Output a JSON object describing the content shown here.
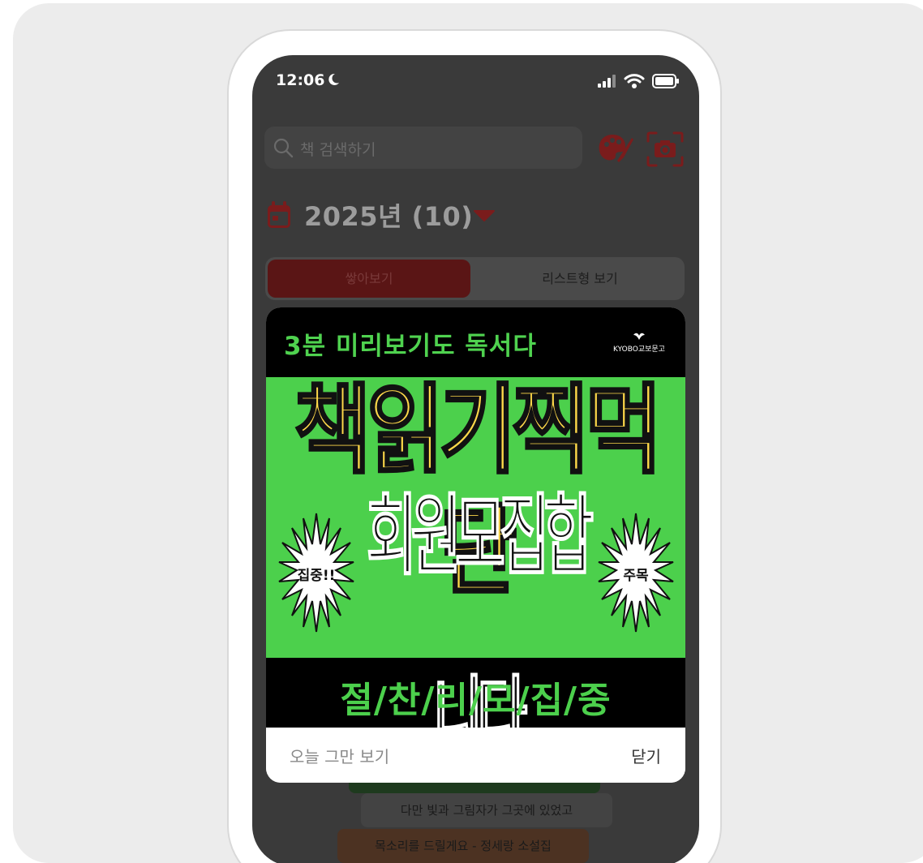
{
  "status_bar": {
    "time": "12:06"
  },
  "search": {
    "placeholder": "책 검색하기"
  },
  "year_selector": {
    "label": "2025년 (10)"
  },
  "view_toggle": {
    "tab_stack": "쌓아보기",
    "tab_list": "리스트형 보기",
    "selected": "쌓아보기"
  },
  "books": [
    "",
    "다만 빛과 그림자가 그곳에 있었고",
    "목소리를 드릴게요 - 정세랑 소설집"
  ],
  "popup": {
    "ad": {
      "headline": "3분 미리보기도 독서다",
      "logo_text": "KYOBO교보문고",
      "main_title": "책읽기찍먹단",
      "sub_title": "회원모집합니다",
      "burst_left": "집중!!",
      "burst_right": "주목",
      "slogan": "절/찬/리/모/집/중"
    },
    "dismiss_today_label": "오늘 그만 보기",
    "close_label": "닫기"
  },
  "colors": {
    "accent_red": "#c0392b",
    "ad_green": "#4cd04c",
    "ad_yellow": "#ffd94a"
  }
}
